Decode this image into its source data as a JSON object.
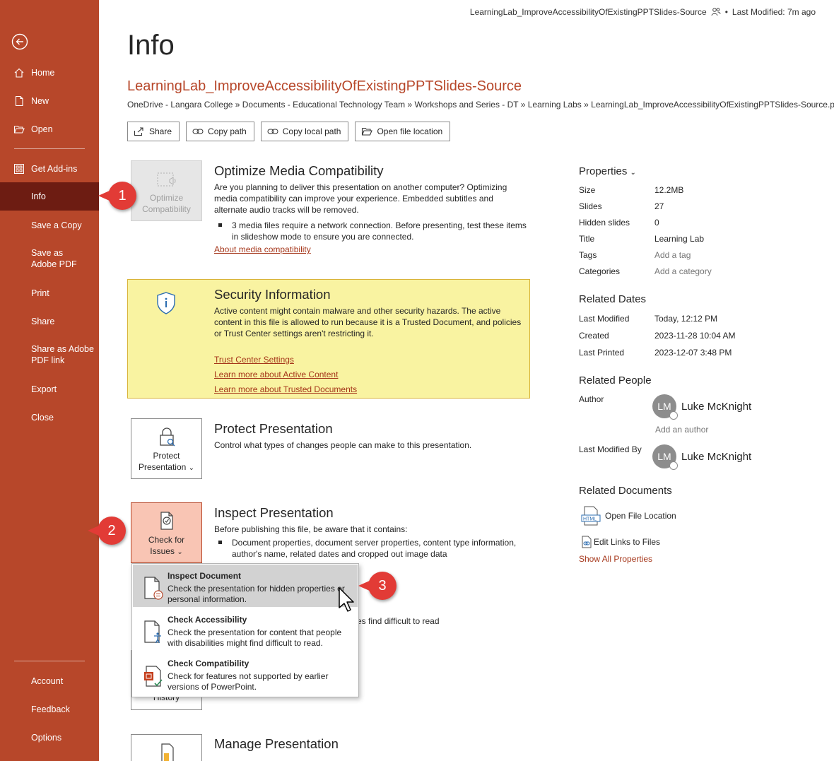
{
  "sidebar": {
    "items": [
      {
        "label": "Home"
      },
      {
        "label": "New"
      },
      {
        "label": "Open"
      },
      {
        "label": "Get Add-ins"
      },
      {
        "label": "Info"
      },
      {
        "label": "Save a Copy"
      },
      {
        "label": "Save as Adobe PDF"
      },
      {
        "label": "Print"
      },
      {
        "label": "Share"
      },
      {
        "label": "Share as Adobe PDF link"
      },
      {
        "label": "Export"
      },
      {
        "label": "Close"
      }
    ],
    "bottom_items": [
      {
        "label": "Account"
      },
      {
        "label": "Feedback"
      },
      {
        "label": "Options"
      }
    ],
    "active": "Info"
  },
  "topbar": {
    "filename": "LearningLab_ImproveAccessibilityOfExistingPPTSlides-Source",
    "separator": "•",
    "last_modified": "Last Modified: 7m ago"
  },
  "page": {
    "title": "Info",
    "doc_title": "LearningLab_ImproveAccessibilityOfExistingPPTSlides-Source",
    "doc_path": "OneDrive - Langara College » Documents - Educational Technology Team » Workshops and Series - DT » Learning Labs » LearningLab_ImproveAccessibilityOfExistingPPTSlides-Source.pptx"
  },
  "actions": {
    "share": "Share",
    "copy_path": "Copy path",
    "copy_local_path": "Copy local path",
    "open_file_location": "Open file location"
  },
  "optimize": {
    "button_line1": "Optimize",
    "button_line2": "Compatibility",
    "title": "Optimize Media Compatibility",
    "text": "Are you planning to deliver this presentation on another computer? Optimizing media compatibility can improve your experience. Embedded subtitles and alternate audio tracks will be removed.",
    "bullet": "3 media files require a network connection. Before presenting, test these items in slideshow mode to ensure you are connected.",
    "link": "About media compatibility"
  },
  "security": {
    "title": "Security Information",
    "text": "Active content might contain malware and other security hazards. The active content in this file is allowed to run because it is a Trusted Document, and policies or Trust Center settings aren't restricting it.",
    "links": [
      "Trust Center Settings",
      "Learn more about Active Content",
      "Learn more about Trusted Documents"
    ]
  },
  "protect": {
    "button_line1": "Protect",
    "button_line2": "Presentation",
    "chevron": "⌄",
    "title": "Protect Presentation",
    "text": "Control what types of changes people can make to this presentation."
  },
  "inspect": {
    "button_line1": "Check for",
    "button_line2": "Issues",
    "chevron": "⌄",
    "title": "Inspect Presentation",
    "text": "Before publishing this file, be aware that it contains:",
    "bullet": "Document properties, document server properties, content type information, author's name, related dates and cropped out image data",
    "partial_text": "es find difficult to read"
  },
  "history_button": "History",
  "manage": {
    "title": "Manage Presentation"
  },
  "dropdown": {
    "items": [
      {
        "title": "Inspect Document",
        "desc": "Check the presentation for hidden properties or personal information."
      },
      {
        "title": "Check Accessibility",
        "desc": "Check the presentation for content that people with disabilities might find difficult to read."
      },
      {
        "title": "Check Compatibility",
        "desc": "Check for features not supported by earlier versions of PowerPoint."
      }
    ]
  },
  "properties": {
    "header": "Properties",
    "rows": [
      {
        "label": "Size",
        "value": "12.2MB"
      },
      {
        "label": "Slides",
        "value": "27"
      },
      {
        "label": "Hidden slides",
        "value": "0"
      },
      {
        "label": "Title",
        "value": "Learning Lab"
      },
      {
        "label": "Tags",
        "value": "Add a tag"
      },
      {
        "label": "Categories",
        "value": "Add a category"
      }
    ],
    "related_dates_header": "Related Dates",
    "dates": [
      {
        "label": "Last Modified",
        "value": "Today, 12:12 PM"
      },
      {
        "label": "Created",
        "value": "2023-11-28 10:04 AM"
      },
      {
        "label": "Last Printed",
        "value": "2023-12-07 3:48 PM"
      }
    ],
    "related_people_header": "Related People",
    "author_label": "Author",
    "author_initials": "LM",
    "author_name": "Luke McKnight",
    "add_author": "Add an author",
    "last_modified_by_label": "Last Modified By",
    "modifier_initials": "LM",
    "modifier_name": "Luke McKnight",
    "related_docs_header": "Related Documents",
    "open_file_location": "Open File Location",
    "edit_links": "Edit Links to Files",
    "show_all": "Show All Properties"
  },
  "callouts": [
    "1",
    "2",
    "3"
  ],
  "colors": {
    "accent": "#b7472a",
    "active_nav": "#6d1c12",
    "security_bg": "#f9f3a1",
    "callout": "#e23b36"
  }
}
